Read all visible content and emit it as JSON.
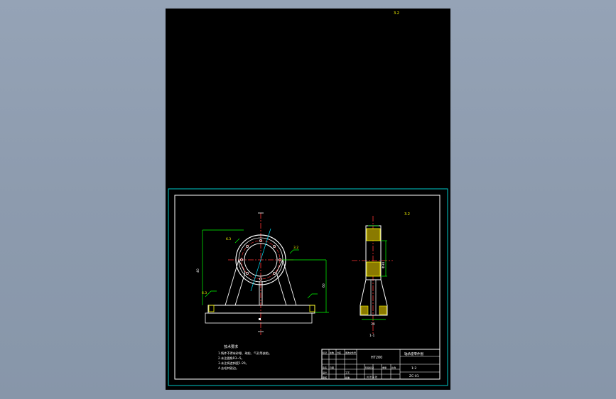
{
  "colors": {
    "viewport_bg": "#8f9db0",
    "canvas_bg": "#000000",
    "outer_frame": "#00c8c8",
    "inner_frame": "#ffffff",
    "part_lines": "#ffffff",
    "dimension_lines": "#00ff00",
    "center_lines": "#ff3333",
    "hatch": "#ffff00",
    "leader": "#00e5ff"
  },
  "drawing": {
    "corner_mark_top": "3.2",
    "corner_mark_sheet": "3.2",
    "roughness_labels": [
      "6.3",
      "3.2",
      "6.3"
    ],
    "dim_height": "40",
    "dim_right": "60",
    "dim_side_vertical": "Φ38",
    "dim_side_bottom": "30",
    "section_label": "1-1",
    "notes_title": "技术要求",
    "notes": [
      "1.铸件不得有砂眼、疏松、气孔等缺陷。",
      "2.未注圆角R3~5。",
      "3.未注铸造斜度1:20。",
      "4.去毛刺锐边。"
    ]
  },
  "title_block": {
    "material": "HT200",
    "part_name": "轴承座零件图",
    "scale": "1:2",
    "drawing_no": "ZC-01",
    "row_labels": [
      "标记",
      "处数",
      "分区",
      "更改文件号",
      "签名",
      "日期"
    ],
    "role_labels": [
      "设计",
      "审核",
      "工艺",
      "批准"
    ],
    "stage_labels": [
      "阶段标记",
      "重量",
      "比例"
    ],
    "sheet_label": "共 张 第 张"
  }
}
